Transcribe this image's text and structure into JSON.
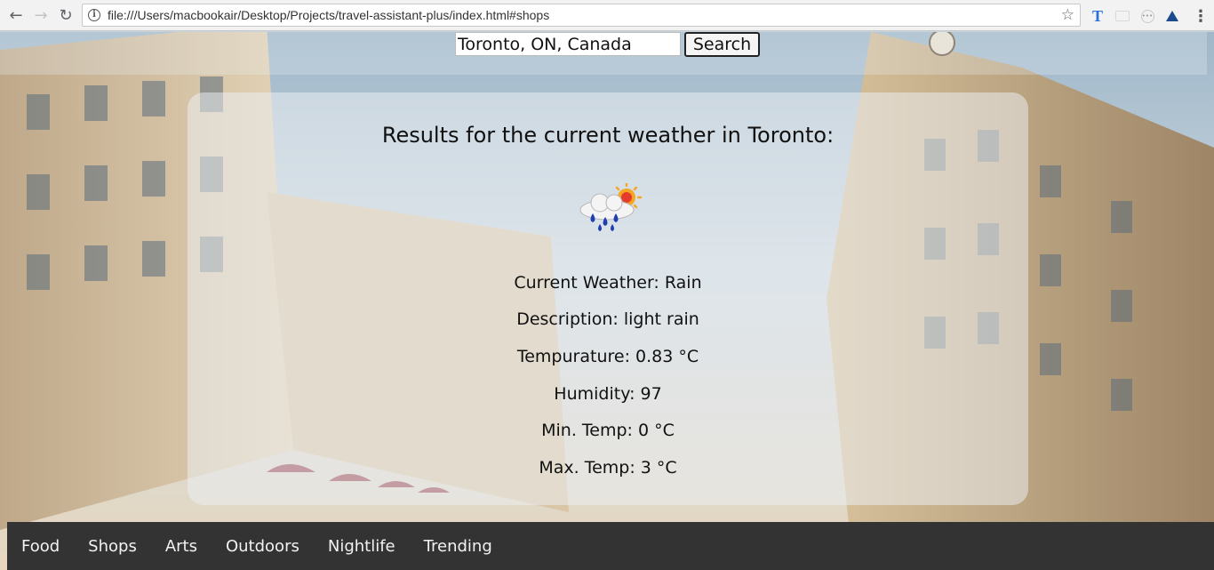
{
  "browser": {
    "url": "file:///Users/macbookair/Desktop/Projects/travel-assistant-plus/index.html#shops"
  },
  "search": {
    "value": "Toronto, ON, Canada",
    "button_label": "Search"
  },
  "results": {
    "title": "Results for the current weather in Toronto:",
    "icon": "rain-cloud-sun-icon",
    "stats": [
      {
        "label": "Current Weather: Rain"
      },
      {
        "label": "Description: light rain"
      },
      {
        "label": "Tempurature: 0.83 °C"
      },
      {
        "label": "Humidity: 97"
      },
      {
        "label": "Min. Temp: 0 °C"
      },
      {
        "label": "Max. Temp: 3 °C"
      }
    ]
  },
  "nav": {
    "items": [
      "Food",
      "Shops",
      "Arts",
      "Outdoors",
      "Nightlife",
      "Trending"
    ]
  },
  "colors": {
    "nav_bg": "#333333",
    "nav_text": "#f2f2f2"
  }
}
